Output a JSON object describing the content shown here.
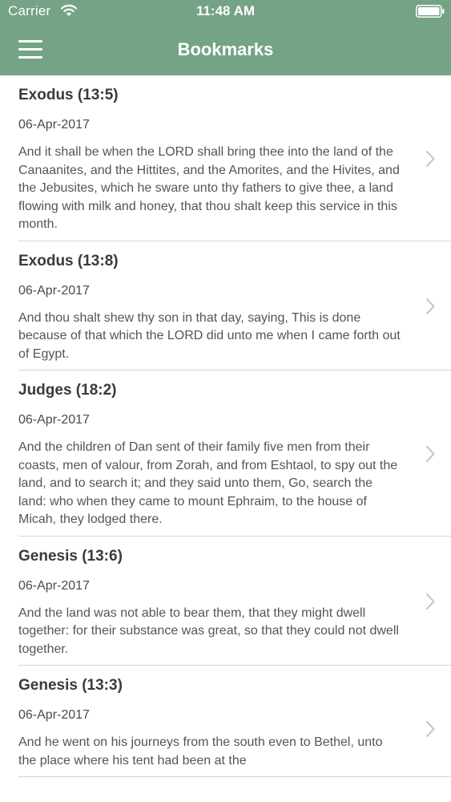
{
  "status_bar": {
    "carrier": "Carrier",
    "time": "11:48 AM",
    "wifi_icon": "wifi-icon",
    "battery_icon": "battery-icon"
  },
  "nav_bar": {
    "title": "Bookmarks",
    "menu_icon": "hamburger-menu-icon",
    "background_color": "#74a386"
  },
  "bookmarks": [
    {
      "title": "Exodus (13:5)",
      "date": "06-Apr-2017",
      "text": "And it shall be when the LORD shall bring thee into the land of the Canaanites, and the Hittites, and the Amorites, and the Hivites, and the Jebusites, which he sware unto thy fathers to give thee, a land flowing with milk and honey, that thou shalt keep this service in this month."
    },
    {
      "title": "Exodus (13:8)",
      "date": "06-Apr-2017",
      "text": "And thou shalt shew thy son in that day, saying, This is done because of that which the LORD did unto me when I came forth out of Egypt."
    },
    {
      "title": "Judges (18:2)",
      "date": "06-Apr-2017",
      "text": "And the children of Dan sent of their family five men from their coasts, men of valour, from Zorah, and from Eshtaol, to spy out the land, and to search it; and they said unto them, Go, search the land: who when they came to mount Ephraim, to the house of Micah, they lodged there."
    },
    {
      "title": "Genesis (13:6)",
      "date": "06-Apr-2017",
      "text": "And the land was not able to bear them, that they might dwell together: for their substance was great, so that they could not dwell together."
    },
    {
      "title": "Genesis (13:3)",
      "date": "06-Apr-2017",
      "text": "And he went on his journeys from the south even to Bethel, unto the place where his tent had been at the"
    }
  ]
}
